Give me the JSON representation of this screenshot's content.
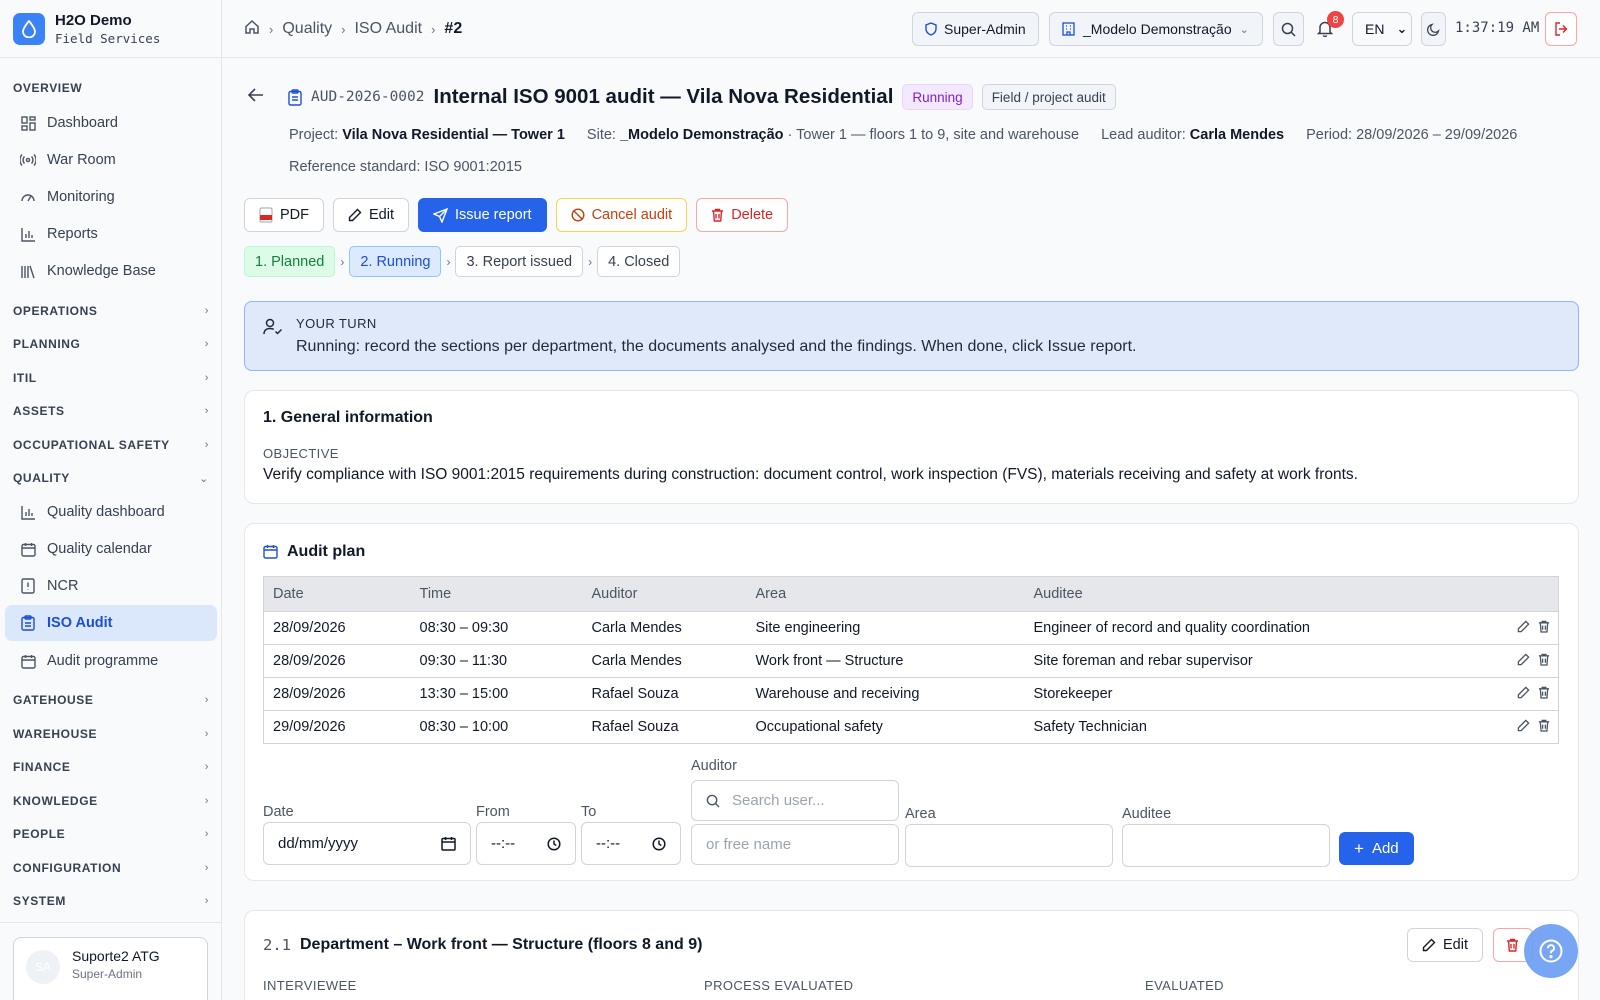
{
  "brand": {
    "title": "H2O Demo",
    "subtitle": "Field Services"
  },
  "sidebar": {
    "overview_label": "OVERVIEW",
    "overview_items": [
      {
        "label": "Dashboard",
        "icon": "grid-icon"
      },
      {
        "label": "War Room",
        "icon": "radio-icon"
      },
      {
        "label": "Monitoring",
        "icon": "gauge-icon"
      },
      {
        "label": "Reports",
        "icon": "bar-chart-icon"
      },
      {
        "label": "Knowledge Base",
        "icon": "library-icon"
      }
    ],
    "groups": {
      "operations": "OPERATIONS",
      "planning": "PLANNING",
      "itil": "ITIL",
      "assets": "ASSETS",
      "safety": "OCCUPATIONAL SAFETY",
      "quality": "QUALITY",
      "gatehouse": "GATEHOUSE",
      "warehouse": "WAREHOUSE",
      "finance": "FINANCE",
      "knowledge": "KNOWLEDGE",
      "people": "PEOPLE",
      "configuration": "CONFIGURATION",
      "system": "SYSTEM"
    },
    "quality_items": [
      {
        "label": "Quality dashboard",
        "icon": "bar-chart-icon"
      },
      {
        "label": "Quality calendar",
        "icon": "calendar-icon"
      },
      {
        "label": "NCR",
        "icon": "alert-file-icon"
      },
      {
        "label": "ISO Audit",
        "icon": "clipboard-icon",
        "active": true
      },
      {
        "label": "Audit programme",
        "icon": "calendar-icon"
      }
    ]
  },
  "user": {
    "initials": "SA",
    "name": "Suporte2 ATG",
    "role": "Super-Admin"
  },
  "topbar": {
    "crumbs": [
      "Quality",
      "ISO Audit"
    ],
    "current": "#2",
    "role": "Super-Admin",
    "tenant": "_Modelo Demonstração",
    "notifications": "8",
    "language": "EN",
    "clock": "1:37:19 AM"
  },
  "audit": {
    "code": "AUD-2026-0002",
    "title": "Internal ISO 9001 audit — Vila Nova Residential",
    "status": "Running",
    "type": "Field / project audit",
    "project_label": "Project:",
    "project": "Vila Nova Residential — Tower 1",
    "site_label": "Site:",
    "site": "_Modelo Demonstração",
    "site_detail": "· Tower 1 — floors 1 to 9, site and warehouse",
    "lead_label": "Lead auditor:",
    "lead": "Carla Mendes",
    "period": "Period: 28/09/2026 – 29/09/2026",
    "standard": "Reference standard: ISO 9001:2015"
  },
  "actions": {
    "pdf": "PDF",
    "edit": "Edit",
    "issue": "Issue report",
    "cancel": "Cancel audit",
    "delete": "Delete"
  },
  "steps": [
    "1. Planned",
    "2. Running",
    "3. Report issued",
    "4. Closed"
  ],
  "turn": {
    "label": "YOUR TURN",
    "text": "Running: record the sections per department, the documents analysed and the findings. When done, click Issue report."
  },
  "general": {
    "title": "1. General information",
    "objective_label": "OBJECTIVE",
    "objective": "Verify compliance with ISO 9001:2015 requirements during construction: document control, work inspection (FVS), materials receiving and safety at work fronts."
  },
  "plan": {
    "title": "Audit plan",
    "columns": [
      "Date",
      "Time",
      "Auditor",
      "Area",
      "Auditee"
    ],
    "rows": [
      [
        "28/09/2026",
        "08:30 – 09:30",
        "Carla Mendes",
        "Site engineering",
        "Engineer of record and quality coordination"
      ],
      [
        "28/09/2026",
        "09:30 – 11:30",
        "Carla Mendes",
        "Work front — Structure",
        "Site foreman and rebar supervisor"
      ],
      [
        "28/09/2026",
        "13:30 – 15:00",
        "Rafael Souza",
        "Warehouse and receiving",
        "Storekeeper"
      ],
      [
        "29/09/2026",
        "08:30 – 10:00",
        "Rafael Souza",
        "Occupational safety",
        "Safety Technician"
      ]
    ],
    "form": {
      "date_label": "Date",
      "date_placeholder": "dd/mm/yyyy",
      "from_label": "From",
      "to_label": "To",
      "time_placeholder": "--:--",
      "auditor_label": "Auditor",
      "auditor_search": "Search user...",
      "auditor_free": "or free name",
      "area_label": "Area",
      "auditee_label": "Auditee",
      "add": "Add"
    }
  },
  "department": {
    "number": "2.1",
    "title": "Department – Work front — Structure (floors 8 and 9)",
    "edit": "Edit",
    "col_interviewee": "INTERVIEWEE",
    "col_process": "PROCESS EVALUATED",
    "col_evaluated": "EVALUATED"
  }
}
